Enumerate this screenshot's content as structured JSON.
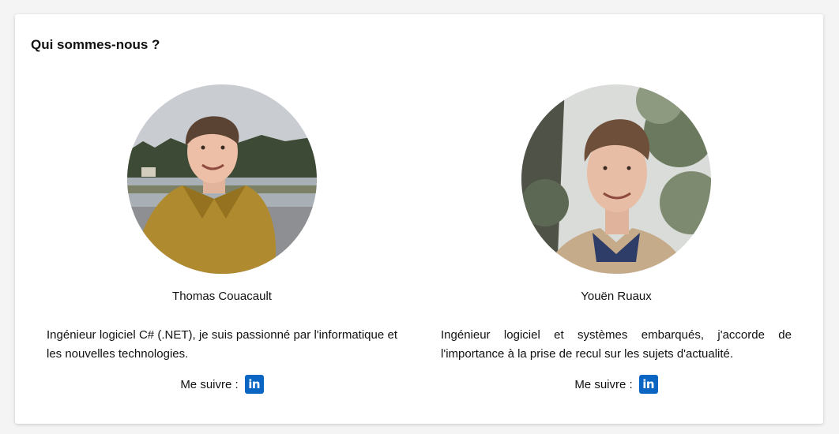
{
  "section": {
    "title": "Qui sommes-nous ?"
  },
  "team": [
    {
      "name": "Thomas Couacault",
      "bio": "Ingénieur logiciel C# (.NET), je suis passionné par l'informatique et les nouvelles technologies.",
      "follow_label": "Me suivre :",
      "social_icon": "linkedin-icon",
      "social_text": "in"
    },
    {
      "name": "Youën Ruaux",
      "bio": "Ingénieur logiciel et systèmes embarqués, j'accorde de l'importance à la prise de recul sur les sujets d'actualité.",
      "follow_label": "Me suivre :",
      "social_icon": "linkedin-icon",
      "social_text": "in"
    }
  ],
  "colors": {
    "linkedin": "#0a66c2",
    "card_background": "#ffffff",
    "page_background": "#f4f4f5"
  }
}
